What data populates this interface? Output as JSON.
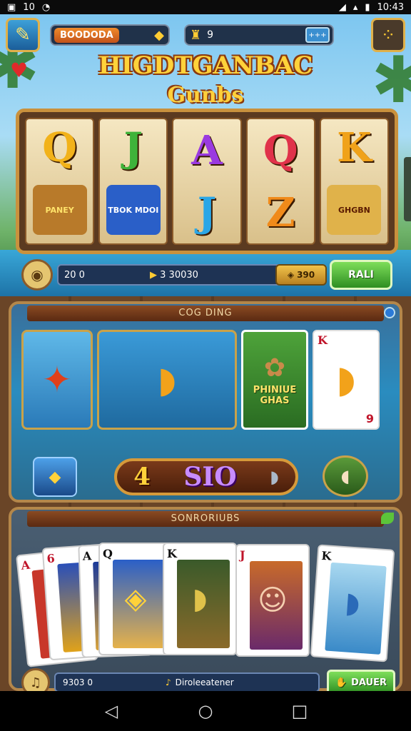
{
  "status_bar": {
    "left_icons": [
      "gallery-icon",
      "notification-icon"
    ],
    "left_text": "10",
    "time": "10:43",
    "right_icons": [
      "signal-icon",
      "wifi-icon",
      "battery-icon"
    ]
  },
  "hud": {
    "coin_label": "BOODODA",
    "lamp_value": "9",
    "plus_label": "+++"
  },
  "title": {
    "line1": "HIGDTGANBAC",
    "line2": "Gunbs"
  },
  "reels": [
    {
      "top": "Q",
      "top_color": "#f2b21a",
      "bottom_label": "PANEY",
      "bottom_color": "#b87a2a"
    },
    {
      "top": "J",
      "top_color": "#3fb33a",
      "bottom_label": "TBOK MDOI",
      "bottom_color": "#2a5fc8"
    },
    {
      "top": "A",
      "top_color": "#9a3ae0",
      "bottom": "J",
      "bottom_color": "#2aa6e6"
    },
    {
      "top": "Q",
      "top_color": "#e0324a",
      "bottom": "Z",
      "bottom_color": "#f08a1a"
    },
    {
      "top": "K",
      "top_color": "#f0a21a",
      "bottom_label": "GHGBN",
      "bottom_color": "#e0b24a"
    }
  ],
  "bet_bar": {
    "left_value": "20 0",
    "center_value": "3 30030",
    "gem_value": "390",
    "spin_label": "RALI"
  },
  "panel1": {
    "banner": "COG DING",
    "green_card_text": "PHINIUE GHAS",
    "card_rank": "K",
    "card_rank_bottom": "9",
    "prize_left": "4",
    "prize_value": "SIO"
  },
  "panel2": {
    "banner": "SONRORIUBS",
    "cards": [
      {
        "rank": "A",
        "suit": "♦",
        "color": "red"
      },
      {
        "rank": "6",
        "suit": "♥",
        "color": "red"
      },
      {
        "rank": "A",
        "suit": "♣",
        "color": "black"
      },
      {
        "rank": "Q",
        "suit": "♠",
        "color": "black"
      },
      {
        "rank": "K",
        "suit": "♠",
        "color": "black"
      },
      {
        "rank": "J",
        "suit": "♦",
        "color": "red"
      },
      {
        "rank": "K",
        "suit": "♣",
        "color": "black"
      }
    ],
    "bottom_left": "9303 0",
    "bottom_center": "Diroleeatener",
    "deal_label": "DAUER"
  },
  "colors": {
    "spin_green": "#2e8e22",
    "gold": "#d69a3a",
    "panel_blue": "#2a8cbf"
  }
}
